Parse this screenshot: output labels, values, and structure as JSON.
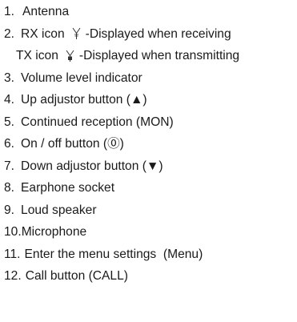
{
  "items": [
    {
      "num": "1.",
      "text": "Antenna"
    },
    {
      "num": "2.",
      "label": "RX icon",
      "icon": "rx-antenna-icon",
      "text": "-Displayed when receiving"
    },
    {
      "label": "TX icon",
      "icon": "tx-antenna-icon",
      "text": "-Displayed when transmitting"
    },
    {
      "num": "3.",
      "text": "Volume level indicator"
    },
    {
      "num": "4.",
      "text": "Up adjustor button (▲)"
    },
    {
      "num": "5.",
      "text": "Continued reception (MON)"
    },
    {
      "num": "6.",
      "text": "On / off button (⓪)"
    },
    {
      "num": "7.",
      "text": "Down adjustor button (▼)"
    },
    {
      "num": "8.",
      "text": "Earphone socket"
    },
    {
      "num": "9.",
      "text": "Loud speaker"
    },
    {
      "num": "10.",
      "text": "Microphone"
    },
    {
      "num": "11.",
      "text": "Enter the menu settings  (Menu)"
    },
    {
      "num": "12.",
      "text": "Call button (CALL)"
    }
  ]
}
